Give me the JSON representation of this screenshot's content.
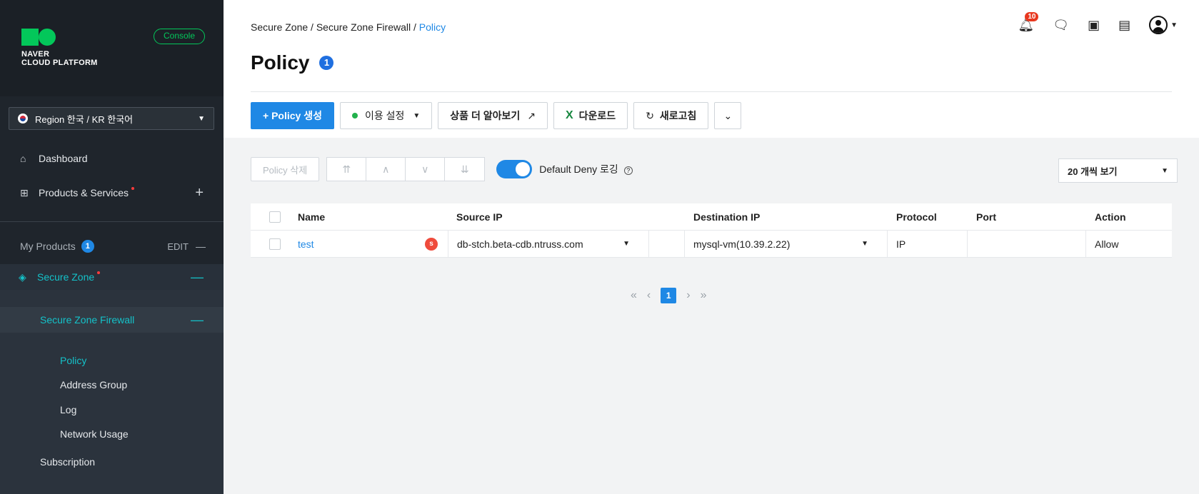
{
  "sidebar": {
    "logo": {
      "line1": "NAVER",
      "line2": "CLOUD PLATFORM"
    },
    "console_label": "Console",
    "region_label": "Region 한국 / KR 한국어",
    "nav": [
      {
        "label": "Dashboard"
      },
      {
        "label": "Products & Services"
      }
    ],
    "my_products": {
      "label": "My Products",
      "count": "1",
      "edit": "EDIT"
    },
    "secure_zone": "Secure Zone",
    "secure_zone_firewall": "Secure Zone Firewall",
    "sub_items": [
      {
        "label": "Policy",
        "active": true
      },
      {
        "label": "Address Group"
      },
      {
        "label": "Log"
      },
      {
        "label": "Network Usage"
      }
    ],
    "subscription": "Subscription"
  },
  "header": {
    "breadcrumb": [
      "Secure Zone /",
      "Secure Zone Firewall /",
      "Policy"
    ],
    "title": "Policy",
    "title_badge": "1",
    "notification_count": "10"
  },
  "toolbar": {
    "create": "+ Policy 생성",
    "usage": "이용 설정",
    "learn_more": "상품 더 알아보기",
    "download": "다운로드",
    "refresh": "새로고침"
  },
  "controls": {
    "delete": "Policy 삭제",
    "toggle_label": "Default Deny 로깅",
    "page_size": "20 개씩 보기"
  },
  "table": {
    "headers": [
      "Name",
      "Source IP",
      "Destination IP",
      "Protocol",
      "Port",
      "Action"
    ],
    "rows": [
      {
        "name": "test",
        "badge": "s",
        "source": "db-stch.beta-cdb.ntruss.com",
        "destination": "mysql-vm(10.39.2.22)",
        "protocol": "IP",
        "port": "",
        "action": "Allow"
      }
    ]
  },
  "pagination": {
    "current": "1"
  },
  "colors": {
    "accent": "#1f88e5",
    "brand": "#03c75a",
    "sidebar_bg": "#1f252c",
    "active_teal": "#14c2c9"
  },
  "icons": [
    "home-icon",
    "grid-icon",
    "bell-icon",
    "chat-icon",
    "memo-icon",
    "calendar-icon",
    "user-icon",
    "external-link-icon",
    "excel-icon",
    "refresh-icon"
  ]
}
